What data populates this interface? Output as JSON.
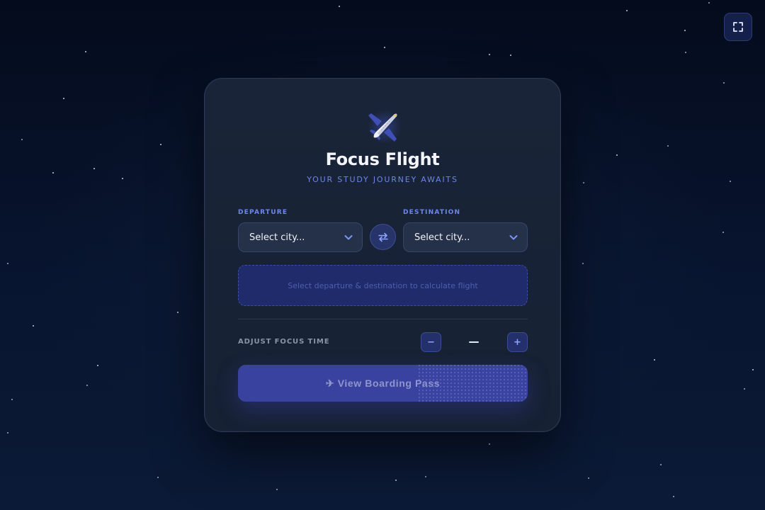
{
  "app": {
    "title": "Focus Flight",
    "subtitle": "YOUR STUDY JOURNEY AWAITS",
    "logo_icon": "airplane-icon"
  },
  "toolbar": {
    "fullscreen_icon": "fullscreen-icon"
  },
  "route": {
    "departure": {
      "label": "DEPARTURE",
      "value": "Select city..."
    },
    "destination": {
      "label": "DESTINATION",
      "value": "Select city..."
    },
    "swap_icon": "swap-arrows-icon"
  },
  "flight_info": {
    "placeholder": "Select departure & destination to calculate flight"
  },
  "focus_time": {
    "label": "ADJUST FOCUS TIME",
    "decrement_label": "−",
    "increment_label": "+",
    "value": "—"
  },
  "actions": {
    "boarding_pass_label": "✈ View Boarding Pass"
  },
  "colors": {
    "background": "#060f24",
    "card": "#1a2438",
    "accent": "#6f87e6",
    "button": "#3b43a0"
  }
}
